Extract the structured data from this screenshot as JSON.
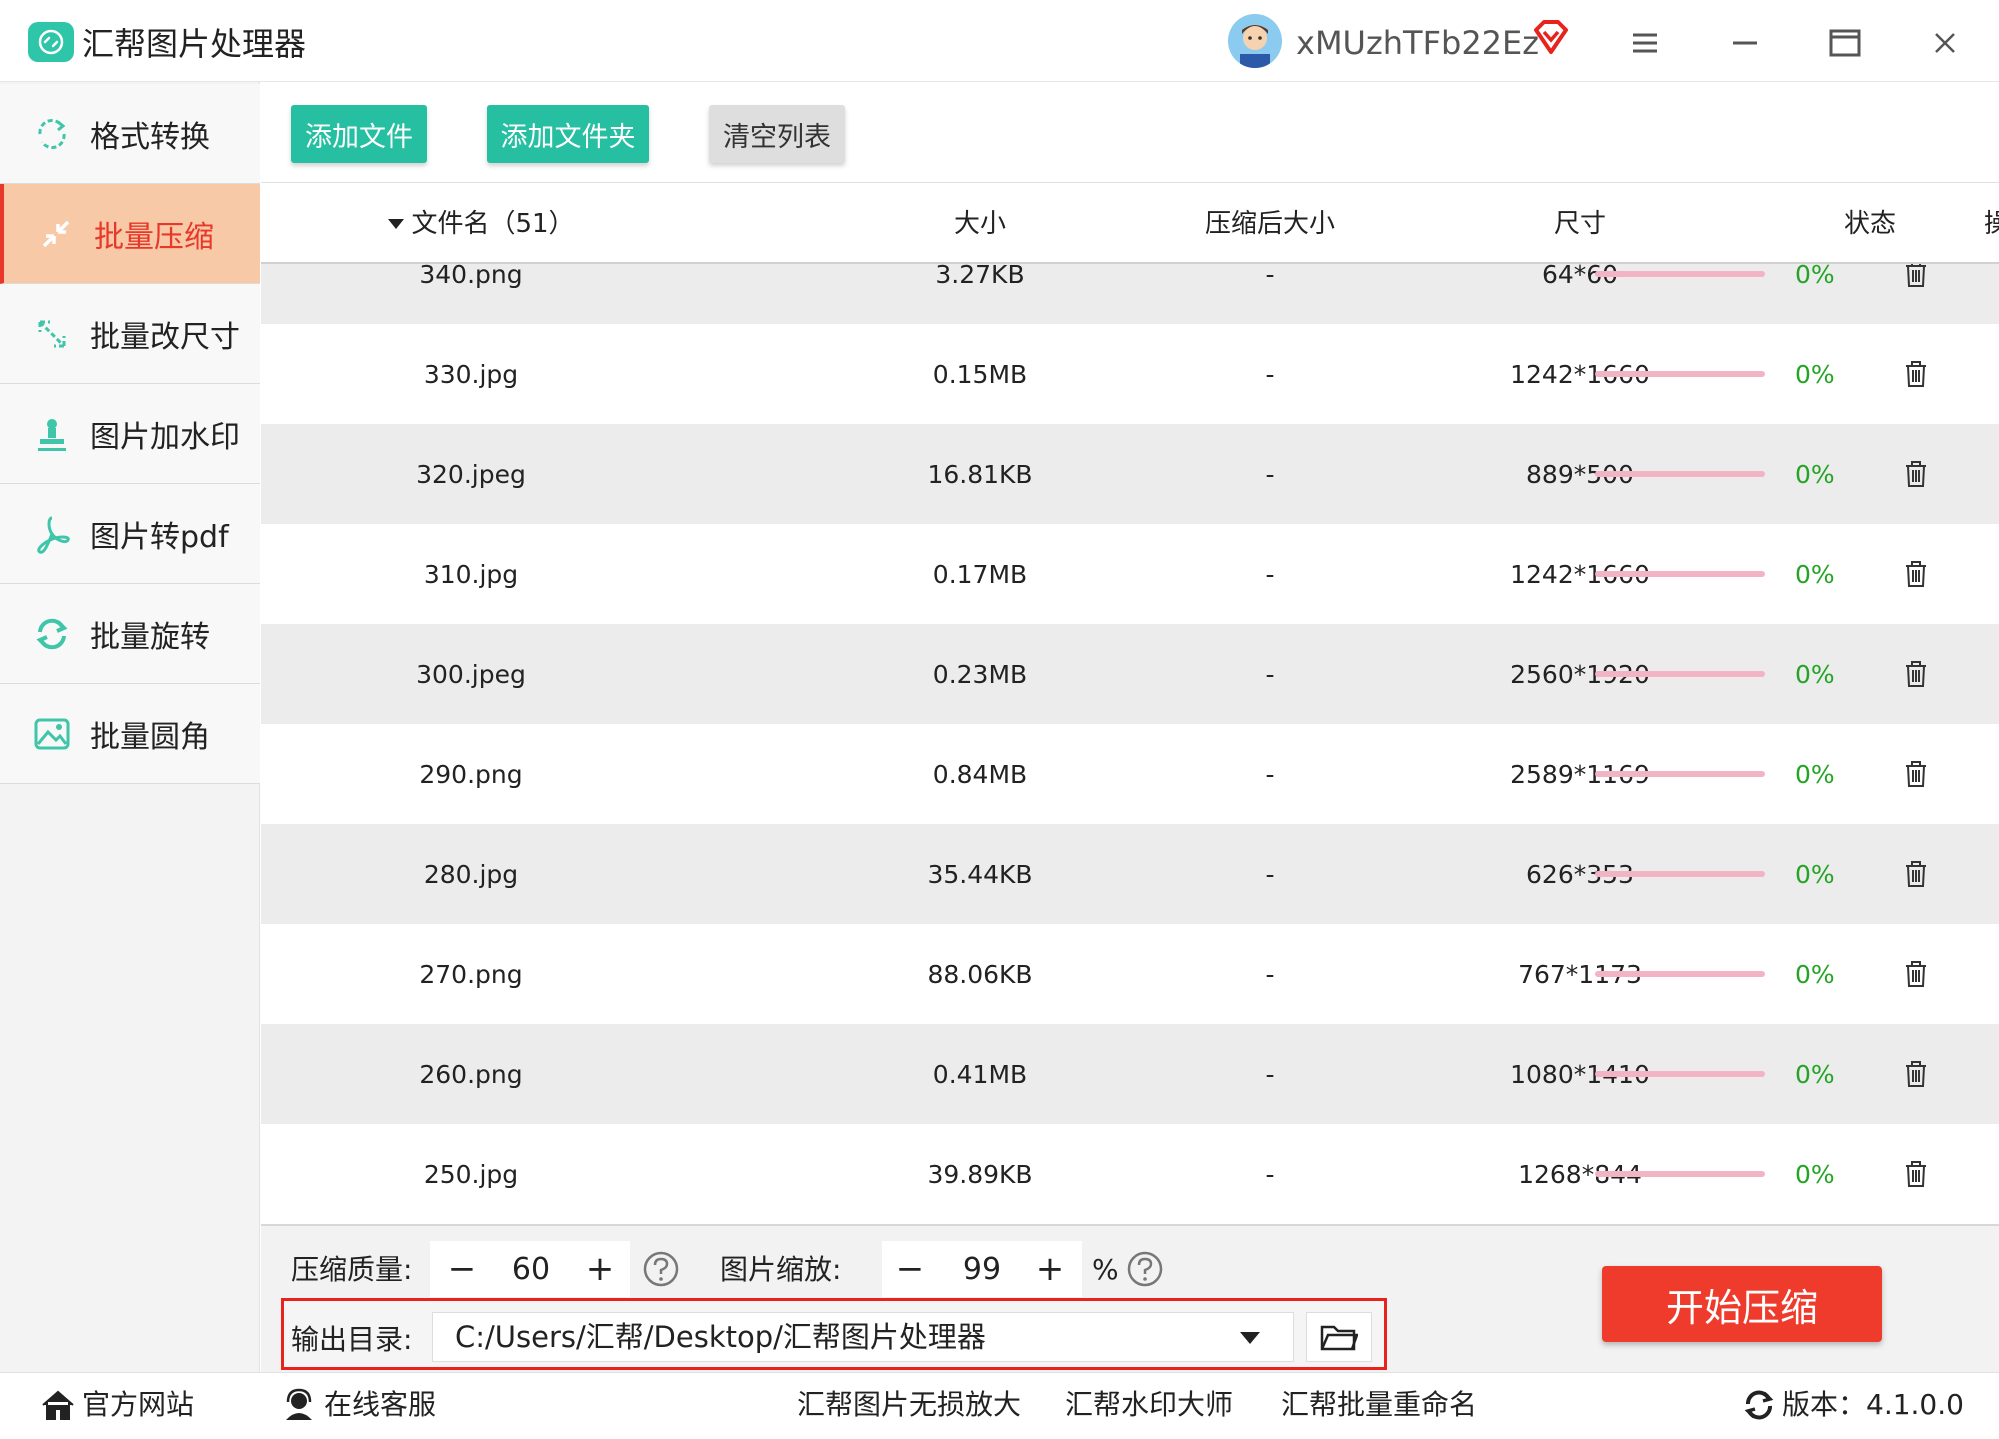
{
  "app": {
    "title": "汇帮图片处理器",
    "username": "xMUzhTFb22Ez"
  },
  "window_controls": [
    "menu-icon",
    "minimize-icon",
    "maximize-icon",
    "close-icon"
  ],
  "toolbar": {
    "add_file": "添加文件",
    "add_folder": "添加文件夹",
    "clear_list": "清空列表"
  },
  "sidebar": {
    "items": [
      {
        "label": "格式转换",
        "icon": "format-convert-icon",
        "active": false
      },
      {
        "label": "批量压缩",
        "icon": "compress-icon",
        "active": true
      },
      {
        "label": "批量改尺寸",
        "icon": "resize-icon",
        "active": false
      },
      {
        "label": "图片加水印",
        "icon": "watermark-icon",
        "active": false
      },
      {
        "label": "图片转pdf",
        "icon": "pdf-icon",
        "active": false
      },
      {
        "label": "批量旋转",
        "icon": "rotate-icon",
        "active": false
      },
      {
        "label": "批量圆角",
        "icon": "round-corner-icon",
        "active": false
      }
    ]
  },
  "table": {
    "columns": {
      "filename": "文件名（51）",
      "size": "大小",
      "compressed_size": "压缩后大小",
      "dimensions": "尺寸",
      "status": "状态",
      "action": "操作"
    },
    "rows": [
      {
        "name": "340.png",
        "size": "3.27KB",
        "compressed": "-",
        "dim": "64*60",
        "progress": "0%"
      },
      {
        "name": "330.jpg",
        "size": "0.15MB",
        "compressed": "-",
        "dim": "1242*1660",
        "progress": "0%"
      },
      {
        "name": "320.jpeg",
        "size": "16.81KB",
        "compressed": "-",
        "dim": "889*500",
        "progress": "0%"
      },
      {
        "name": "310.jpg",
        "size": "0.17MB",
        "compressed": "-",
        "dim": "1242*1660",
        "progress": "0%"
      },
      {
        "name": "300.jpeg",
        "size": "0.23MB",
        "compressed": "-",
        "dim": "2560*1920",
        "progress": "0%"
      },
      {
        "name": "290.png",
        "size": "0.84MB",
        "compressed": "-",
        "dim": "2589*1169",
        "progress": "0%"
      },
      {
        "name": "280.jpg",
        "size": "35.44KB",
        "compressed": "-",
        "dim": "626*353",
        "progress": "0%"
      },
      {
        "name": "270.png",
        "size": "88.06KB",
        "compressed": "-",
        "dim": "767*1173",
        "progress": "0%"
      },
      {
        "name": "260.png",
        "size": "0.41MB",
        "compressed": "-",
        "dim": "1080*1410",
        "progress": "0%"
      },
      {
        "name": "250.jpg",
        "size": "39.89KB",
        "compressed": "-",
        "dim": "1268*844",
        "progress": "0%"
      }
    ]
  },
  "settings": {
    "quality_label": "压缩质量:",
    "quality_minus": "−",
    "quality_value": "60",
    "quality_plus": "+",
    "scale_label": "图片缩放:",
    "scale_minus": "−",
    "scale_value": "99",
    "scale_plus": "+",
    "scale_unit": "%",
    "output_label": "输出目录:",
    "output_path": "C:/Users/汇帮/Desktop/汇帮图片处理器",
    "start_button": "开始压缩"
  },
  "footer": {
    "website": "官方网站",
    "support": "在线客服",
    "link1": "汇帮图片无损放大",
    "link2": "汇帮水印大师",
    "link3": "汇帮批量重命名",
    "version": "版本：4.1.0.0"
  },
  "colors": {
    "accent_green": "#26bfa1",
    "active_red": "#e8372b",
    "start_red": "#ef3b2c",
    "progress_pink": "#f2b3c4",
    "percent_green": "#24a324"
  }
}
